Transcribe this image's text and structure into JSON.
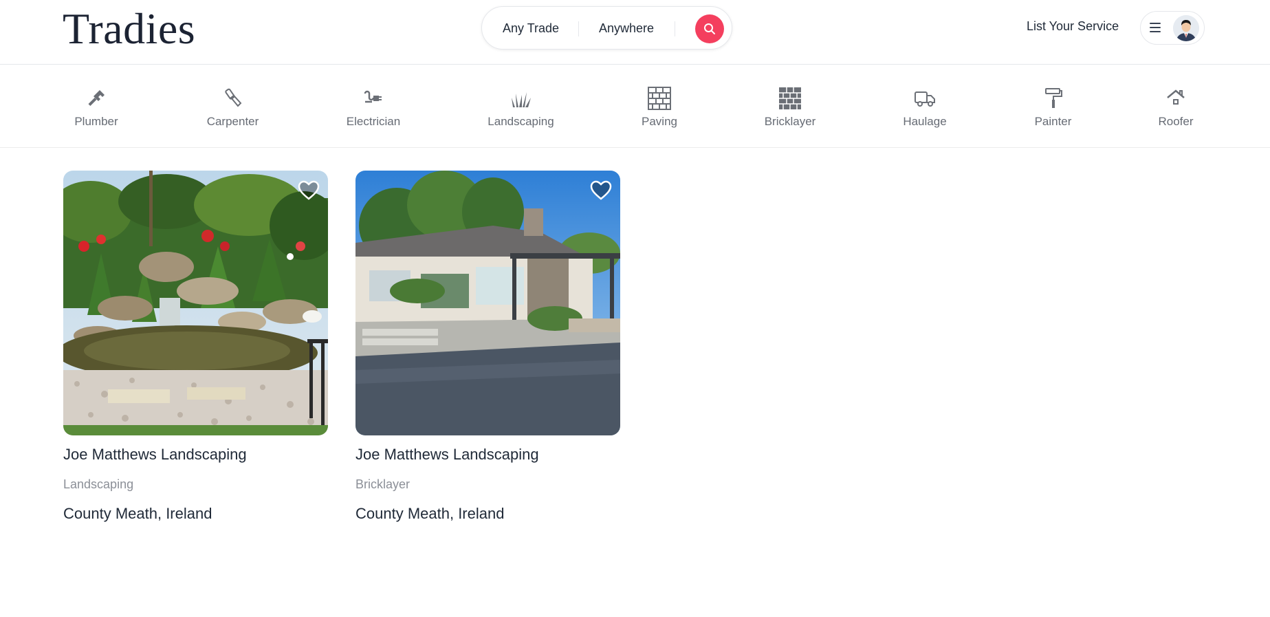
{
  "header": {
    "logo": "Tradies",
    "search": {
      "trade": "Any Trade",
      "location": "Anywhere"
    },
    "list_service": "List Your Service"
  },
  "categories": [
    {
      "label": "Plumber",
      "icon": "wrench-icon"
    },
    {
      "label": "Carpenter",
      "icon": "chisel-icon"
    },
    {
      "label": "Electrician",
      "icon": "plug-icon"
    },
    {
      "label": "Landscaping",
      "icon": "grass-icon"
    },
    {
      "label": "Paving",
      "icon": "paving-icon"
    },
    {
      "label": "Bricklayer",
      "icon": "brick-wall-icon"
    },
    {
      "label": "Haulage",
      "icon": "truck-icon"
    },
    {
      "label": "Painter",
      "icon": "paint-roller-icon"
    },
    {
      "label": "Roofer",
      "icon": "roof-icon"
    }
  ],
  "listings": [
    {
      "title": "Joe Matthews Landscaping",
      "category": "Landscaping",
      "location": "County Meath, Ireland"
    },
    {
      "title": "Joe Matthews Landscaping",
      "category": "Bricklayer",
      "location": "County Meath, Ireland"
    }
  ],
  "colors": {
    "accent": "#f43f5e",
    "text": "#1f2937",
    "muted": "#8b8f97"
  }
}
